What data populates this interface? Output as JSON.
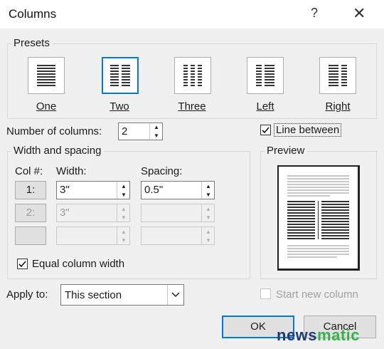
{
  "dialog": {
    "title": "Columns",
    "help": "?",
    "close": "✕"
  },
  "presets": {
    "label": "Presets",
    "items": [
      {
        "label": "One",
        "selected": false
      },
      {
        "label": "Two",
        "selected": true
      },
      {
        "label": "Three",
        "selected": false
      },
      {
        "label": "Left",
        "selected": false
      },
      {
        "label": "Right",
        "selected": false
      }
    ]
  },
  "num_columns": {
    "label": "Number of columns:",
    "value": "2"
  },
  "line_between": {
    "label": "Line between",
    "checked": true
  },
  "width_spacing": {
    "label": "Width and spacing",
    "col_header": "Col #:",
    "width_header": "Width:",
    "spacing_header": "Spacing:",
    "rows": [
      {
        "col": "1:",
        "width": "3\"",
        "spacing": "0.5\"",
        "enabled": true
      },
      {
        "col": "2:",
        "width": "3\"",
        "spacing": "",
        "enabled": false
      },
      {
        "col": "",
        "width": "",
        "spacing": "",
        "enabled": false
      }
    ]
  },
  "equal_width": {
    "label": "Equal column width",
    "checked": true
  },
  "preview": {
    "label": "Preview"
  },
  "apply_to": {
    "label": "Apply to:",
    "value": "This section"
  },
  "start_new_column": {
    "label": "Start new column",
    "checked": false
  },
  "buttons": {
    "ok": "OK",
    "cancel": "Cancel"
  },
  "watermark": {
    "part1": "news",
    "part2": "matic"
  },
  "colors": {
    "accent": "#0078d7",
    "dialog_bg": "#f0f0f0"
  }
}
